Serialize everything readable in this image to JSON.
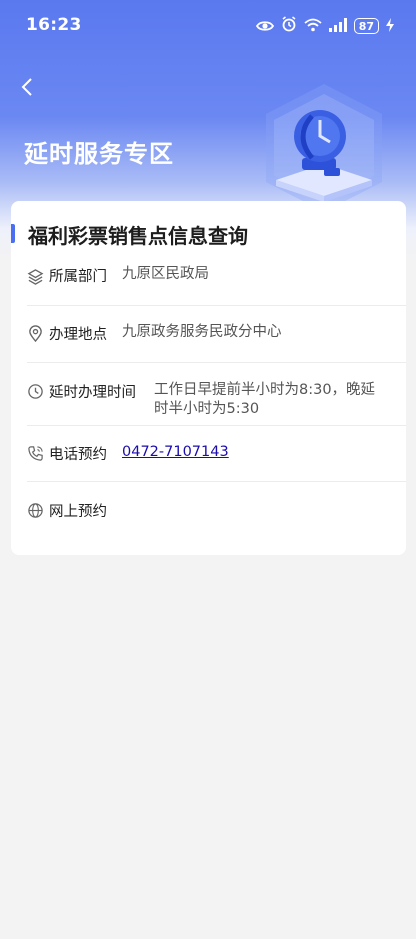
{
  "status_bar": {
    "time": "16:23",
    "battery": "87",
    "icons": [
      "eye-icon",
      "alarm-icon",
      "wifi-icon",
      "signal-icon",
      "battery-icon",
      "charging-icon"
    ]
  },
  "header": {
    "title": "延时服务专区"
  },
  "card": {
    "title": "福利彩票销售点信息查询",
    "rows": [
      {
        "icon": "layers-icon",
        "label": "所属部门",
        "value": "九原区民政局"
      },
      {
        "icon": "location-pin-icon",
        "label": "办理地点",
        "value": "九原政务服务民政分中心"
      },
      {
        "icon": "clock-icon",
        "label": "延时办理时间",
        "value_line1": "工作日早提前半小时为8:30，晚延",
        "value_line2": "时半小时为5:30"
      },
      {
        "icon": "phone-icon",
        "label": "电话预约",
        "value": "0472-7107143"
      },
      {
        "icon": "globe-icon",
        "label": "网上预约",
        "value": ""
      }
    ]
  },
  "colors": {
    "header_gradient_top": "#5a79ef",
    "accent": "#4a6ff0",
    "link": "#1a0dab",
    "background": "#f3f3f3"
  }
}
